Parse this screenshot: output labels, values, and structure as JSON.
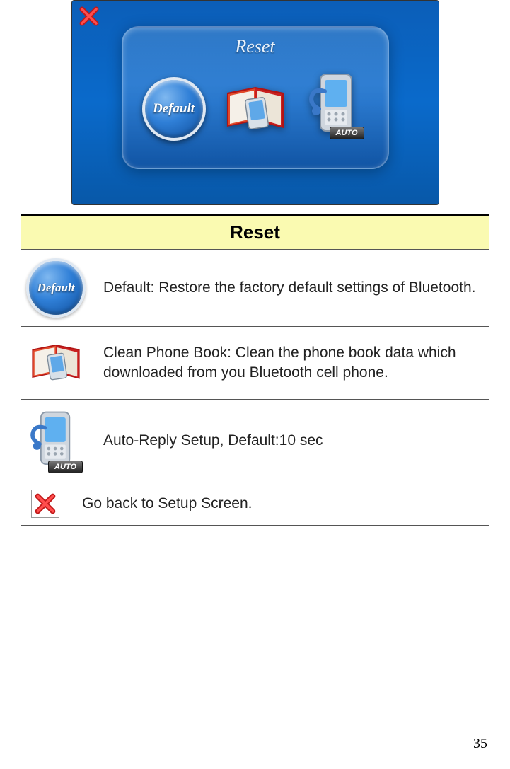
{
  "screenshot": {
    "title": "Reset",
    "buttons": {
      "default_label": "Default",
      "auto_tag": "AUTO"
    }
  },
  "section": {
    "header": "Reset"
  },
  "rows": [
    {
      "icon_label": "Default",
      "text": "Default:  Restore the factory default settings of Bluetooth."
    },
    {
      "text": "Clean Phone Book: Clean the phone book data which downloaded from you Bluetooth cell phone."
    },
    {
      "auto_tag": "AUTO",
      "text": "Auto-Reply Setup, Default:10 sec"
    },
    {
      "text": "Go back to Setup Screen."
    }
  ],
  "page_number": "35"
}
